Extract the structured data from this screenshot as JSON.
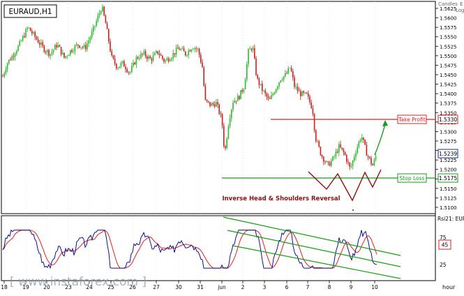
{
  "symbol": "EURAUD,H1",
  "chart_mode": "Candles",
  "chart_mode_suffix": "E",
  "scale_mode": "Log",
  "price_axis": {
    "ticks": [
      "1.5625",
      "1.5600",
      "1.5575",
      "1.5550",
      "1.5525",
      "1.5500",
      "1.5475",
      "1.5450",
      "1.5425",
      "1.5400",
      "1.5375",
      "1.5350",
      "1.5325",
      "1.5300",
      "1.5275",
      "1.5250",
      "1.5225",
      "1.5200",
      "1.5175",
      "1.5150",
      "1.5125",
      "1.5100"
    ]
  },
  "levels": {
    "take_profit": {
      "label": "Take Profit",
      "value": "1.5330",
      "price": 1.533,
      "color": "#e02020"
    },
    "current": {
      "value": "1.5239",
      "price": 1.5239,
      "color": "#1030a0"
    },
    "stop_loss": {
      "label": "Stop Loss",
      "value": "1.5175",
      "price": 1.5175,
      "color": "#1a9a1a"
    }
  },
  "annotation": "Inverse Head & Shoulders Reversal",
  "rsi": {
    "label": "Rsi21",
    "label_suffix": "EUR",
    "value": "45",
    "ticks": [
      "75",
      "25"
    ]
  },
  "time_axis": {
    "labels": [
      "18",
      "19",
      "20",
      "23",
      "24",
      "25",
      "26",
      "27",
      "30",
      "31",
      "jun",
      "2",
      "3",
      "6",
      "7",
      "8",
      "9",
      "10"
    ],
    "unit": "hour"
  },
  "watermark": "[ www.instaforex.com ]",
  "colors": {
    "bull": "#2db82d",
    "bear": "#c82020",
    "rsi_line": "#10108a",
    "rsi_ma": "#e02020",
    "channel": "#1a9a1a"
  }
}
